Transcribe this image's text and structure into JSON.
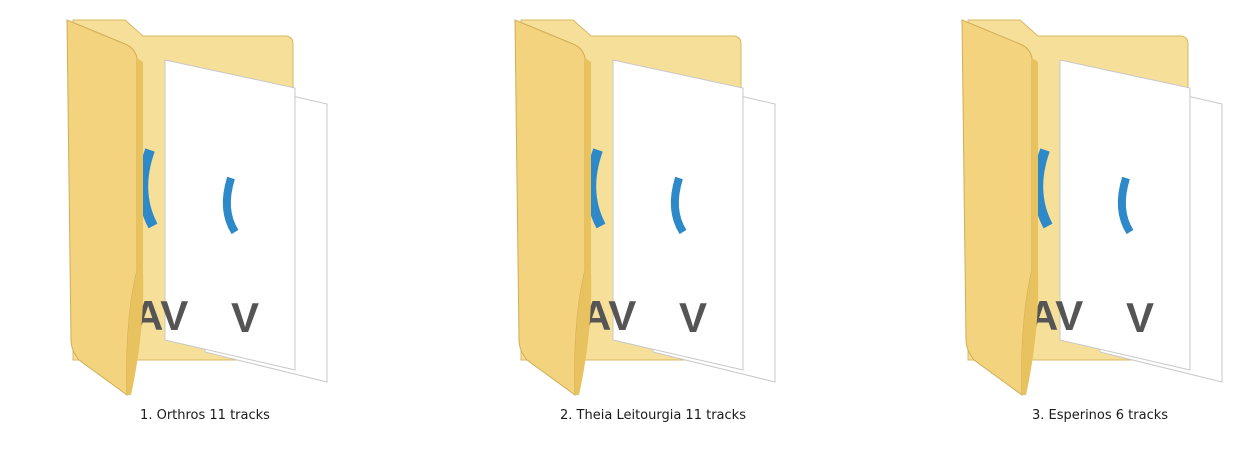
{
  "window": {
    "title": ""
  },
  "folders": [
    {
      "label": "1. Orthros 11 tracks",
      "icon": "audio-folder-icon",
      "file_badge": "WAV"
    },
    {
      "label": "2. Theia Leitourgia 11 tracks",
      "icon": "audio-folder-icon",
      "file_badge": "WAV"
    },
    {
      "label": "3. Esperinos 6 tracks",
      "icon": "audio-folder-icon",
      "file_badge": "WAV"
    }
  ],
  "colors": {
    "folder_front": "#f3d37d",
    "folder_back": "#f6df98",
    "paper": "#ffffff",
    "audio_symbol": "#2d89c8",
    "badge_text": "#555555"
  }
}
